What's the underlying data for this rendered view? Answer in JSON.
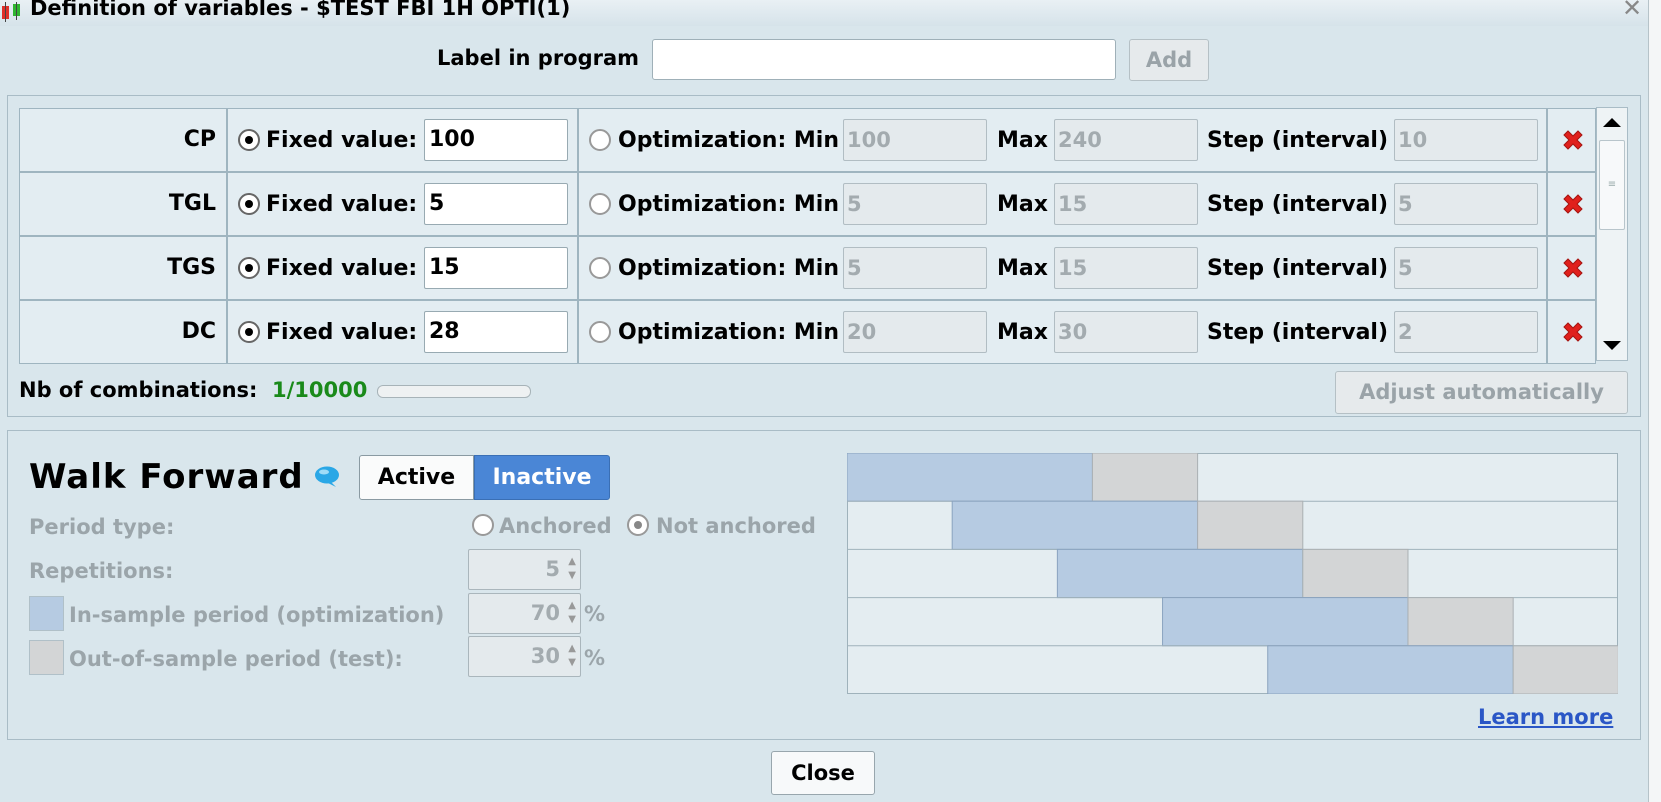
{
  "window": {
    "title": "Definition of variables - $TEST FBI 1H OPTI(1)",
    "close_glyph": "✕",
    "icon": "candlestick-app-icon"
  },
  "label_bar": {
    "label": "Label in program",
    "value": "",
    "add_label": "Add"
  },
  "variables": [
    {
      "name": "CP",
      "fixed_label": "Fixed value:",
      "fixed_value": "100",
      "opt_label": "Optimization: Min",
      "min": "100",
      "max_label": "Max",
      "max": "240",
      "step_label": "Step (interval)",
      "step": "10"
    },
    {
      "name": "TGL",
      "fixed_label": "Fixed value:",
      "fixed_value": "5",
      "opt_label": "Optimization: Min",
      "min": "5",
      "max_label": "Max",
      "max": "15",
      "step_label": "Step (interval)",
      "step": "5"
    },
    {
      "name": "TGS",
      "fixed_label": "Fixed value:",
      "fixed_value": "15",
      "opt_label": "Optimization: Min",
      "min": "5",
      "max_label": "Max",
      "max": "15",
      "step_label": "Step (interval)",
      "step": "5"
    },
    {
      "name": "DC",
      "fixed_label": "Fixed value:",
      "fixed_value": "28",
      "opt_label": "Optimization: Min",
      "min": "20",
      "max_label": "Max",
      "max": "30",
      "step_label": "Step (interval)",
      "step": "2"
    }
  ],
  "combinations": {
    "label": "Nb of combinations:",
    "value": "1/10000",
    "progress": 0.0001,
    "value_color": "#1a8a1a"
  },
  "adjust_label": "Adjust automatically",
  "walk_forward": {
    "title": "Walk Forward",
    "info_icon": "speech-bubble-icon",
    "toggle": {
      "active": "Active",
      "inactive": "Inactive",
      "selected": "Inactive"
    },
    "period_type_label": "Period type:",
    "anchored_label": "Anchored",
    "not_anchored_label": "Not anchored",
    "selected_period_type": "Not anchored",
    "repetitions_label": "Repetitions:",
    "repetitions": "5",
    "in_sample_label": "In-sample period (optimization)",
    "in_sample_value": "70",
    "out_sample_label": "Out-of-sample period (test):",
    "out_sample_value": "30",
    "percent": "%",
    "in_sample_color": "#b6cbe2",
    "out_sample_color": "#d3d5d6",
    "learn_more": "Learn more"
  },
  "close_label": "Close"
}
